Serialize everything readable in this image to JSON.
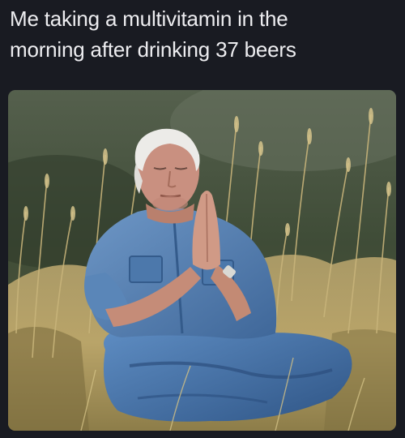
{
  "meme": {
    "caption_lines": [
      "Me taking a multivitamin in the",
      "morning after drinking 37 beers"
    ]
  },
  "photo": {
    "subject": "white-haired man in denim shirt and jeans sitting in tall grass with palms pressed together",
    "colors": {
      "background": "#191b22",
      "caption_text": "#ededf0",
      "distant_hills": "#3b4a34",
      "grass": "#b6a265",
      "denim": "#5a86b8",
      "denim_dark": "#375d8c",
      "skin": "#c99080",
      "hair": "#e8e6e2"
    }
  }
}
